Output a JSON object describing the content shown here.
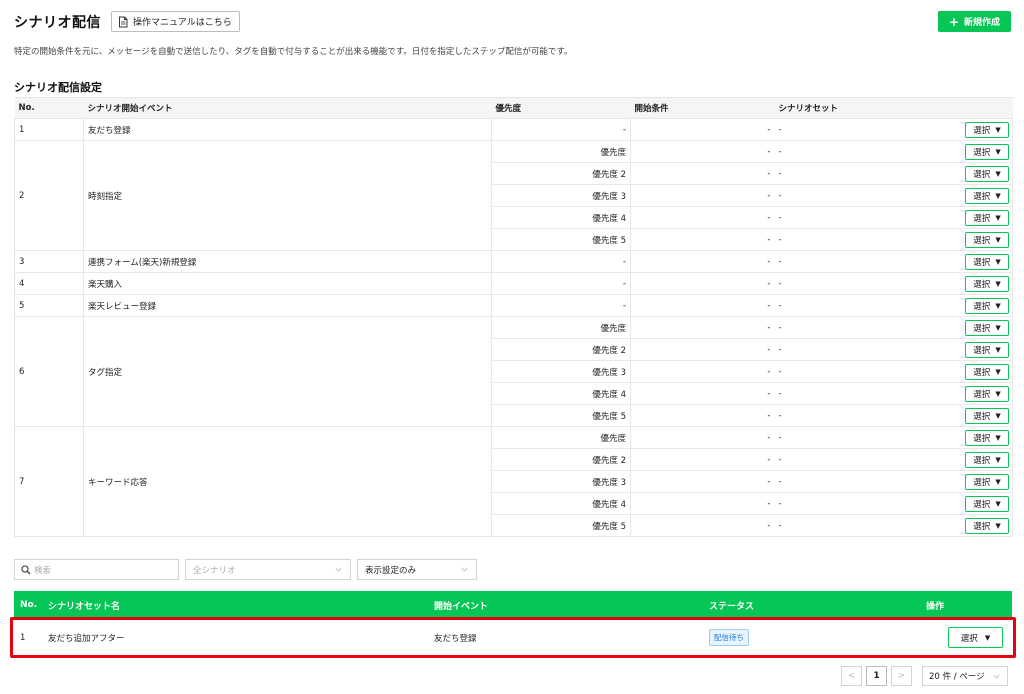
{
  "header": {
    "title": "シナリオ配信",
    "manual_label": "操作マニュアルはこちら",
    "new_label": "新規作成"
  },
  "description": "特定の開始条件を元に、メッセージを自動で送信したり、タグを自動で付与することが出来る機能です。日付を指定したステップ配信が可能です。",
  "settings": {
    "section_title": "シナリオ配信設定",
    "columns": [
      "No.",
      "シナリオ開始イベント",
      "優先度",
      "開始条件",
      "シナリオセット"
    ],
    "select_label": "選択",
    "groups": [
      {
        "no": "1",
        "event": "友だち登録",
        "rows": [
          {
            "priority": "-",
            "condition": "-",
            "set": "-"
          }
        ]
      },
      {
        "no": "2",
        "event": "時刻指定",
        "rows": [
          {
            "priority": "優先度",
            "condition": "-",
            "set": "-"
          },
          {
            "priority": "優先度 2",
            "condition": "-",
            "set": "-"
          },
          {
            "priority": "優先度 3",
            "condition": "-",
            "set": "-"
          },
          {
            "priority": "優先度 4",
            "condition": "-",
            "set": "-"
          },
          {
            "priority": "優先度 5",
            "condition": "-",
            "set": "-"
          }
        ]
      },
      {
        "no": "3",
        "event": "連携フォーム(楽天)新規登録",
        "rows": [
          {
            "priority": "-",
            "condition": "-",
            "set": "-"
          }
        ]
      },
      {
        "no": "4",
        "event": "楽天購入",
        "rows": [
          {
            "priority": "-",
            "condition": "-",
            "set": "-"
          }
        ]
      },
      {
        "no": "5",
        "event": "楽天レビュー登録",
        "rows": [
          {
            "priority": "-",
            "condition": "-",
            "set": "-"
          }
        ]
      },
      {
        "no": "6",
        "event": "タグ指定",
        "rows": [
          {
            "priority": "優先度",
            "condition": "-",
            "set": "-"
          },
          {
            "priority": "優先度 2",
            "condition": "-",
            "set": "-"
          },
          {
            "priority": "優先度 3",
            "condition": "-",
            "set": "-"
          },
          {
            "priority": "優先度 4",
            "condition": "-",
            "set": "-"
          },
          {
            "priority": "優先度 5",
            "condition": "-",
            "set": "-"
          }
        ]
      },
      {
        "no": "7",
        "event": "キーワード応答",
        "rows": [
          {
            "priority": "優先度",
            "condition": "-",
            "set": "-"
          },
          {
            "priority": "優先度 2",
            "condition": "-",
            "set": "-"
          },
          {
            "priority": "優先度 3",
            "condition": "-",
            "set": "-"
          },
          {
            "priority": "優先度 4",
            "condition": "-",
            "set": "-"
          },
          {
            "priority": "優先度 5",
            "condition": "-",
            "set": "-"
          }
        ]
      }
    ]
  },
  "filters": {
    "search_placeholder": "検索",
    "scenario_filter": "全シナリオ",
    "display_filter": "表示設定のみ"
  },
  "set_table": {
    "columns": [
      "No.",
      "シナリオセット名",
      "開始イベント",
      "ステータス",
      "操作"
    ],
    "rows": [
      {
        "no": "1",
        "name": "友だち追加アフター",
        "event": "友だち登録",
        "status": "配信待ち",
        "op": "選択"
      }
    ]
  },
  "pagination": {
    "prev": "<",
    "page": "1",
    "next": ">",
    "page_size": "20 件 / ページ"
  },
  "colors": {
    "accent": "#06c755",
    "highlight": "#e60012",
    "status_badge": "#1f7ad1"
  }
}
